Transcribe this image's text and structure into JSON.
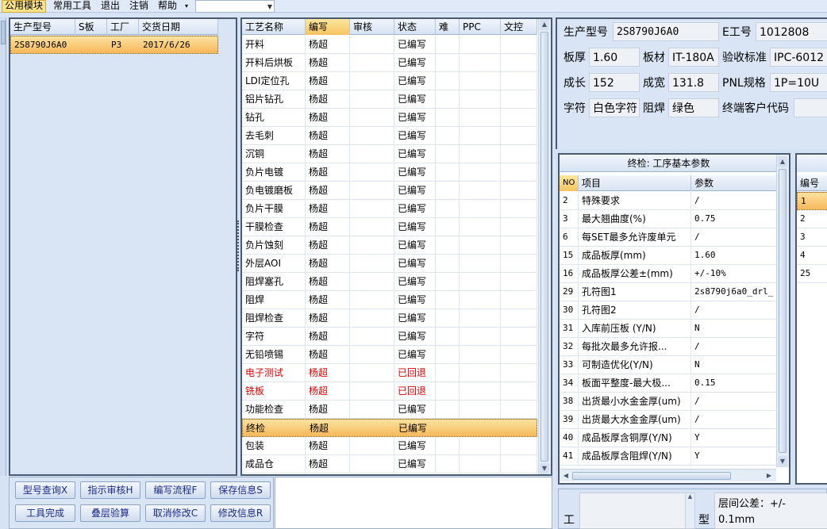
{
  "menu": {
    "items": [
      {
        "label": "公用模块",
        "active": true
      },
      {
        "label": "常用工具"
      },
      {
        "label": "退出"
      },
      {
        "label": "注销"
      },
      {
        "label": "帮助"
      }
    ],
    "combo_value": ""
  },
  "left_grid": {
    "columns": [
      "生产型号",
      "S板",
      "工厂",
      "交货日期"
    ],
    "rows": [
      {
        "model": "2S8790J6A0",
        "s": "",
        "factory": "P3",
        "date": "2017/6/26"
      }
    ]
  },
  "process_grid": {
    "columns": [
      "工艺名称",
      "编写",
      "审核",
      "状态",
      "难",
      "PPC",
      "文控"
    ],
    "rows": [
      {
        "name": "开料",
        "writer": "杨超",
        "status": "已编写"
      },
      {
        "name": "开料后烘板",
        "writer": "杨超",
        "status": "已编写"
      },
      {
        "name": "LDI定位孔",
        "writer": "杨超",
        "status": "已编写"
      },
      {
        "name": "铝片钻孔",
        "writer": "杨超",
        "status": "已编写"
      },
      {
        "name": "钻孔",
        "writer": "杨超",
        "status": "已编写"
      },
      {
        "name": "去毛刺",
        "writer": "杨超",
        "status": "已编写"
      },
      {
        "name": "沉铜",
        "writer": "杨超",
        "status": "已编写"
      },
      {
        "name": "负片电镀",
        "writer": "杨超",
        "status": "已编写"
      },
      {
        "name": "负电镀磨板",
        "writer": "杨超",
        "status": "已编写"
      },
      {
        "name": "负片干膜",
        "writer": "杨超",
        "status": "已编写"
      },
      {
        "name": "干膜检查",
        "writer": "杨超",
        "status": "已编写"
      },
      {
        "name": "负片蚀刻",
        "writer": "杨超",
        "status": "已编写"
      },
      {
        "name": "外层AOI",
        "writer": "杨超",
        "status": "已编写"
      },
      {
        "name": "阻焊塞孔",
        "writer": "杨超",
        "status": "已编写"
      },
      {
        "name": "阻焊",
        "writer": "杨超",
        "status": "已编写"
      },
      {
        "name": "阻焊检查",
        "writer": "杨超",
        "status": "已编写"
      },
      {
        "name": "字符",
        "writer": "杨超",
        "status": "已编写"
      },
      {
        "name": "无铅喷锡",
        "writer": "杨超",
        "status": "已编写"
      },
      {
        "name": "电子测试",
        "writer": "杨超",
        "status": "已回退",
        "red": true
      },
      {
        "name": "铣板",
        "writer": "杨超",
        "status": "已回退",
        "red": true
      },
      {
        "name": "功能检查",
        "writer": "杨超",
        "status": "已编写"
      },
      {
        "name": "终检",
        "writer": "杨超",
        "status": "已编写",
        "selected": true
      },
      {
        "name": "包装",
        "writer": "杨超",
        "status": "已编写"
      },
      {
        "name": "成品仓",
        "writer": "杨超",
        "status": "已编写"
      }
    ]
  },
  "info": {
    "model_label": "生产型号",
    "model_value": "2S8790J6A0",
    "eno_label": "E工号",
    "eno_value": "1012808",
    "thickness_label": "板厚",
    "thickness_value": "1.60",
    "material_label": "板材",
    "material_value": "IT-180A",
    "standard_label": "验收标准",
    "standard_value": "IPC-6012 I",
    "length_label": "成长",
    "length_value": "152",
    "width_label": "成宽",
    "width_value": "131.8",
    "pnl_label": "PNL规格",
    "pnl_value": "1P=10U",
    "char_label": "字符",
    "char_value": "白色字符",
    "mask_label": "阻焊",
    "mask_value": "绿色",
    "customer_label": "终端客户代码",
    "customer_value": ""
  },
  "params": {
    "title": "终检: 工序基本参数",
    "columns": [
      "NO",
      "项目",
      "参数"
    ],
    "rows": [
      {
        "no": "2",
        "item": "特殊要求",
        "value": "/"
      },
      {
        "no": "3",
        "item": "最大翘曲度(%)",
        "value": "0.75"
      },
      {
        "no": "6",
        "item": "每SET最多允许废单元",
        "value": "/"
      },
      {
        "no": "15",
        "item": "成品板厚(mm)",
        "value": "1.60"
      },
      {
        "no": "16",
        "item": "成品板厚公差±(mm)",
        "value": "+/-10%"
      },
      {
        "no": "29",
        "item": "孔符图1",
        "value": "2s8790j6a0_drl_"
      },
      {
        "no": "30",
        "item": "孔符图2",
        "value": "/"
      },
      {
        "no": "31",
        "item": "入库前压板 (Y/N)",
        "value": "N"
      },
      {
        "no": "32",
        "item": "每批次最多允许报...",
        "value": "/"
      },
      {
        "no": "33",
        "item": "可制造优化(Y/N)",
        "value": "N"
      },
      {
        "no": "34",
        "item": "板面平整度-最大极...",
        "value": "0.15"
      },
      {
        "no": "38",
        "item": "出货最小水金金厚(um)",
        "value": "/"
      },
      {
        "no": "39",
        "item": "出货最大水金金厚(um)",
        "value": "/"
      },
      {
        "no": "40",
        "item": "成品板厚含铜厚(Y/N)",
        "value": "Y"
      },
      {
        "no": "41",
        "item": "成品板厚含阻焊(Y/N)",
        "value": "Y"
      }
    ]
  },
  "right_grid": {
    "header": "编号",
    "rows": [
      "1",
      "2",
      "3",
      "4",
      "25"
    ]
  },
  "buttons": [
    {
      "label": "型号查询X"
    },
    {
      "label": "指示审核H"
    },
    {
      "label": "编写流程F"
    },
    {
      "label": "保存信息S"
    },
    {
      "label": "工具完成"
    },
    {
      "label": "叠层验算"
    },
    {
      "label": "取消修改C"
    },
    {
      "label": "修改信息R"
    }
  ],
  "bottom": {
    "tool_label": "工",
    "type_label": "型",
    "tolerance_label": "层间公差：+/-",
    "tolerance_value": "0.1mm"
  }
}
